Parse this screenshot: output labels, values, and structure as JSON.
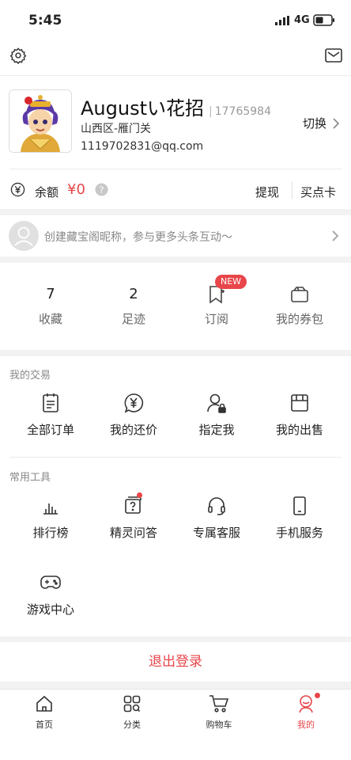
{
  "status_bar": {
    "time": "5:45",
    "network": "4G"
  },
  "profile": {
    "name": "Augustい花招",
    "user_id": "17765984",
    "location": "山西区-雁门关",
    "email": "1119702831@qq.com",
    "switch_label": "切换"
  },
  "balance": {
    "label": "余额",
    "amount": "¥0",
    "withdraw_label": "提现",
    "buy_card_label": "买点卡"
  },
  "nickname_prompt": {
    "text": "创建藏宝阁昵称，参与更多头条互动～"
  },
  "stats": [
    {
      "value": "7",
      "label": "收藏"
    },
    {
      "value": "2",
      "label": "足迹"
    },
    {
      "label": "订阅",
      "badge": "NEW"
    },
    {
      "label": "我的券包"
    }
  ],
  "transactions": {
    "title": "我的交易",
    "items": [
      {
        "label": "全部订单",
        "icon": "order-icon"
      },
      {
        "label": "我的还价",
        "icon": "yen-bubble-icon"
      },
      {
        "label": "指定我",
        "icon": "user-lock-icon"
      },
      {
        "label": "我的出售",
        "icon": "shop-icon"
      }
    ]
  },
  "tools": {
    "title": "常用工具",
    "items": [
      {
        "label": "排行榜",
        "icon": "ranking-icon"
      },
      {
        "label": "精灵问答",
        "icon": "qa-icon"
      },
      {
        "label": "专属客服",
        "icon": "headset-icon"
      },
      {
        "label": "手机服务",
        "icon": "phone-icon"
      },
      {
        "label": "游戏中心",
        "icon": "gamepad-icon"
      }
    ]
  },
  "logout": {
    "label": "退出登录"
  },
  "tab_bar": {
    "items": [
      {
        "label": "首页",
        "icon": "home-icon"
      },
      {
        "label": "分类",
        "icon": "category-icon"
      },
      {
        "label": "购物车",
        "icon": "cart-icon"
      },
      {
        "label": "我的",
        "icon": "profile-icon"
      }
    ]
  },
  "colors": {
    "accent": "#e8464a",
    "muted": "#999999"
  }
}
